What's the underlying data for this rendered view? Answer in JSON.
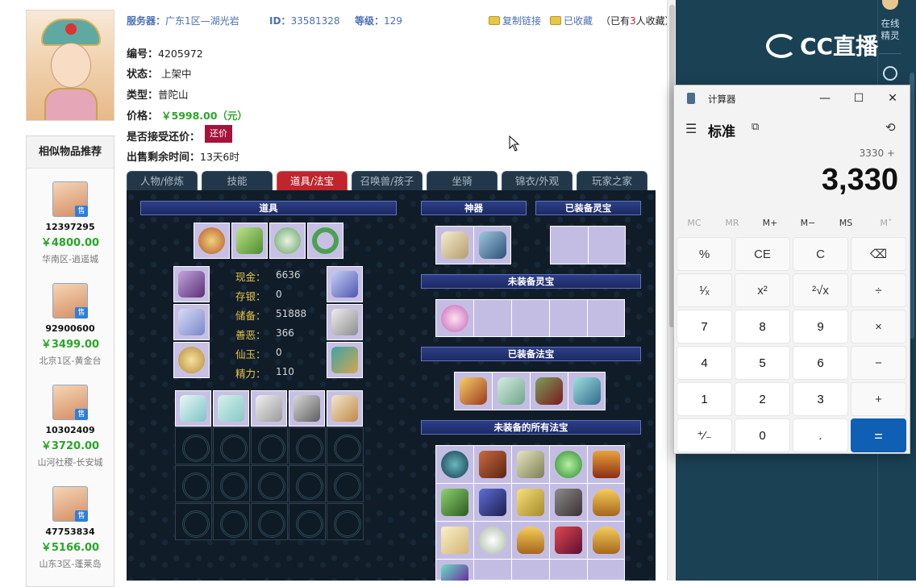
{
  "header": {
    "server_label": "服务器：",
    "server_value": "广东1区—湖光岩",
    "id_label": "ID：",
    "id_value": "33581328",
    "level_label": "等级：",
    "level_value": "129",
    "copy_link": "复制链接",
    "favorited": "已收藏",
    "fav_prefix": "（已有",
    "fav_count": "3",
    "fav_suffix": "人收藏）"
  },
  "info": {
    "number_label": "编号：",
    "number_value": "4205972",
    "status_label": "状态：",
    "status_value": "上架中",
    "type_label": "类型：",
    "type_value": "普陀山",
    "price_label": "价格：",
    "price_value": "￥5998.00（元）",
    "haggle_label": "是否接受还价：",
    "haggle_button": "还价",
    "remaining_label": "出售剩余时间：",
    "remaining_value": "13天6时"
  },
  "sidebar": {
    "title": "相似物品推荐",
    "sale_badge": "售",
    "items": [
      {
        "id": "12397295",
        "price": "￥4800.00",
        "server": "华南区-逍遥城"
      },
      {
        "id": "92900600",
        "price": "￥3499.00",
        "server": "北京1区-黄金台"
      },
      {
        "id": "10302409",
        "price": "￥3720.00",
        "server": "山河社稷-长安城"
      },
      {
        "id": "47753834",
        "price": "￥5166.00",
        "server": "山东3区-蓬莱岛"
      }
    ]
  },
  "tabs": [
    {
      "label": "人物/修炼",
      "active": false
    },
    {
      "label": "技能",
      "active": false
    },
    {
      "label": "道具/法宝",
      "active": true
    },
    {
      "label": "召唤兽/孩子",
      "active": false
    },
    {
      "label": "坐骑",
      "active": false
    },
    {
      "label": "锦衣/外观",
      "active": false
    },
    {
      "label": "玩家之家",
      "active": false
    }
  ],
  "panel": {
    "items_title": "道具",
    "artifact_title": "神器",
    "equipped_spirit_title": "已装备灵宝",
    "unequipped_spirit_title": "未装备灵宝",
    "equipped_fabao_title": "已装备法宝",
    "unequipped_fabao_title": "未装备的所有法宝",
    "stats": [
      {
        "label": "现金：",
        "value": "6636"
      },
      {
        "label": "存银：",
        "value": "0"
      },
      {
        "label": "储备：",
        "value": "51888"
      },
      {
        "label": "善恶：",
        "value": "366"
      },
      {
        "label": "仙玉：",
        "value": "0"
      },
      {
        "label": "精力：",
        "value": "110"
      }
    ]
  },
  "right_strip": {
    "online_label": "在线精灵",
    "cc_logo": "CC直播"
  },
  "calculator": {
    "app_title": "计算器",
    "mode": "标准",
    "expression": "3330 +",
    "display": "3,330",
    "memory": [
      "MC",
      "MR",
      "M+",
      "M−",
      "MS",
      "M˅"
    ],
    "keys": [
      [
        "%",
        "CE",
        "C",
        "⌫"
      ],
      [
        "¹⁄ₓ",
        "x²",
        "²√x",
        "÷"
      ],
      [
        "7",
        "8",
        "9",
        "×"
      ],
      [
        "4",
        "5",
        "6",
        "−"
      ],
      [
        "1",
        "2",
        "3",
        "+"
      ],
      [
        "⁺⁄₋",
        "0",
        ".",
        "="
      ]
    ]
  },
  "colors": {
    "accent_blue": "#4a6fb5",
    "price_green": "#2aa52a",
    "haggle_red": "#a5133a",
    "tab_active": "#c0242c",
    "calc_equals": "#0f5fb4"
  }
}
